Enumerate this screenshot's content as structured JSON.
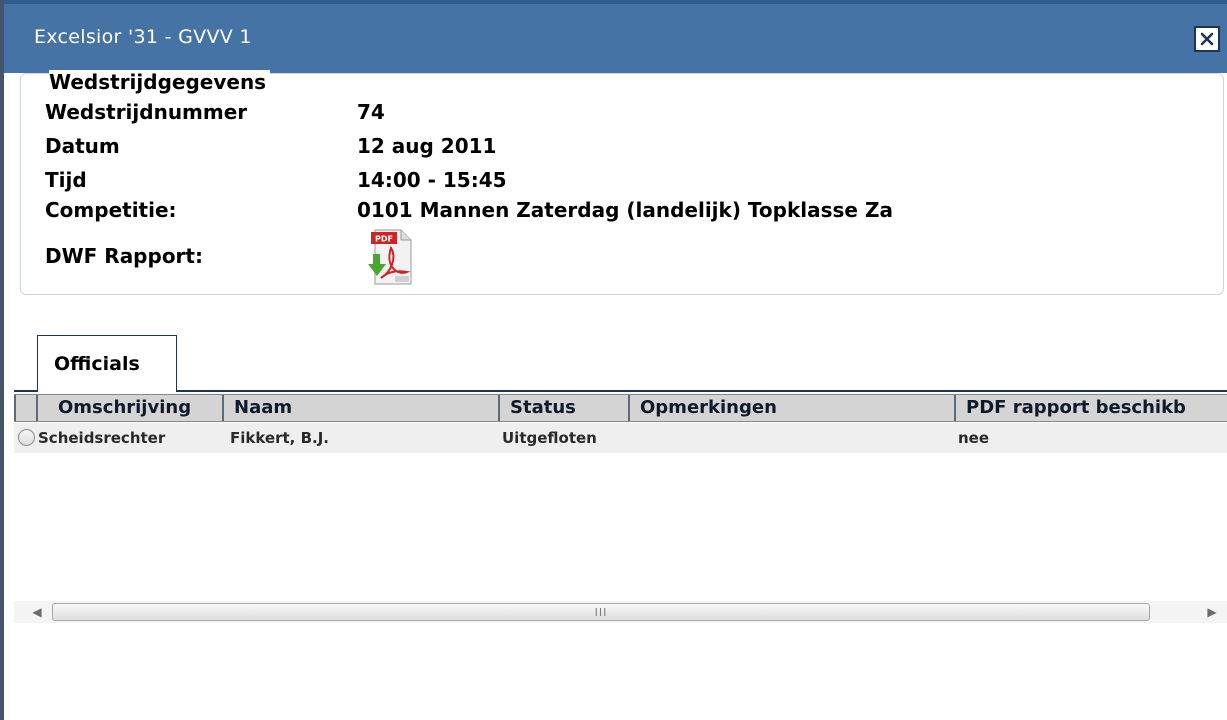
{
  "window": {
    "title": "Excelsior '31 - GVVV 1",
    "close_icon": "close-icon"
  },
  "details": {
    "legend": "Wedstrijdgegevens",
    "rows": [
      {
        "label": "Wedstrijdnummer",
        "value": "74"
      },
      {
        "label": "Datum",
        "value": "12 aug 2011"
      },
      {
        "label": "Tijd",
        "value": "14:00 - 15:45"
      },
      {
        "label": "Competitie:",
        "value": "0101 Mannen Zaterdag (landelijk) Topklasse Za"
      }
    ],
    "report_label": "DWF Rapport:",
    "report_icon": "pdf-download-icon"
  },
  "tabs": [
    {
      "label": "Officials",
      "active": true
    }
  ],
  "table": {
    "columns": [
      "Omschrijving",
      "Naam",
      "Status",
      "Opmerkingen",
      "PDF rapport beschikb"
    ],
    "rows": [
      {
        "omschrijving": "Scheidsrechter",
        "naam": "Fikkert, B.J.",
        "status": "Uitgefloten",
        "opmerkingen": "",
        "pdf": "nee"
      }
    ]
  },
  "scrollbar": {
    "grip": "III"
  },
  "colors": {
    "titlebar": "#4573a6",
    "header_bg": "#d4d4d4",
    "row_bg": "#efefef"
  }
}
